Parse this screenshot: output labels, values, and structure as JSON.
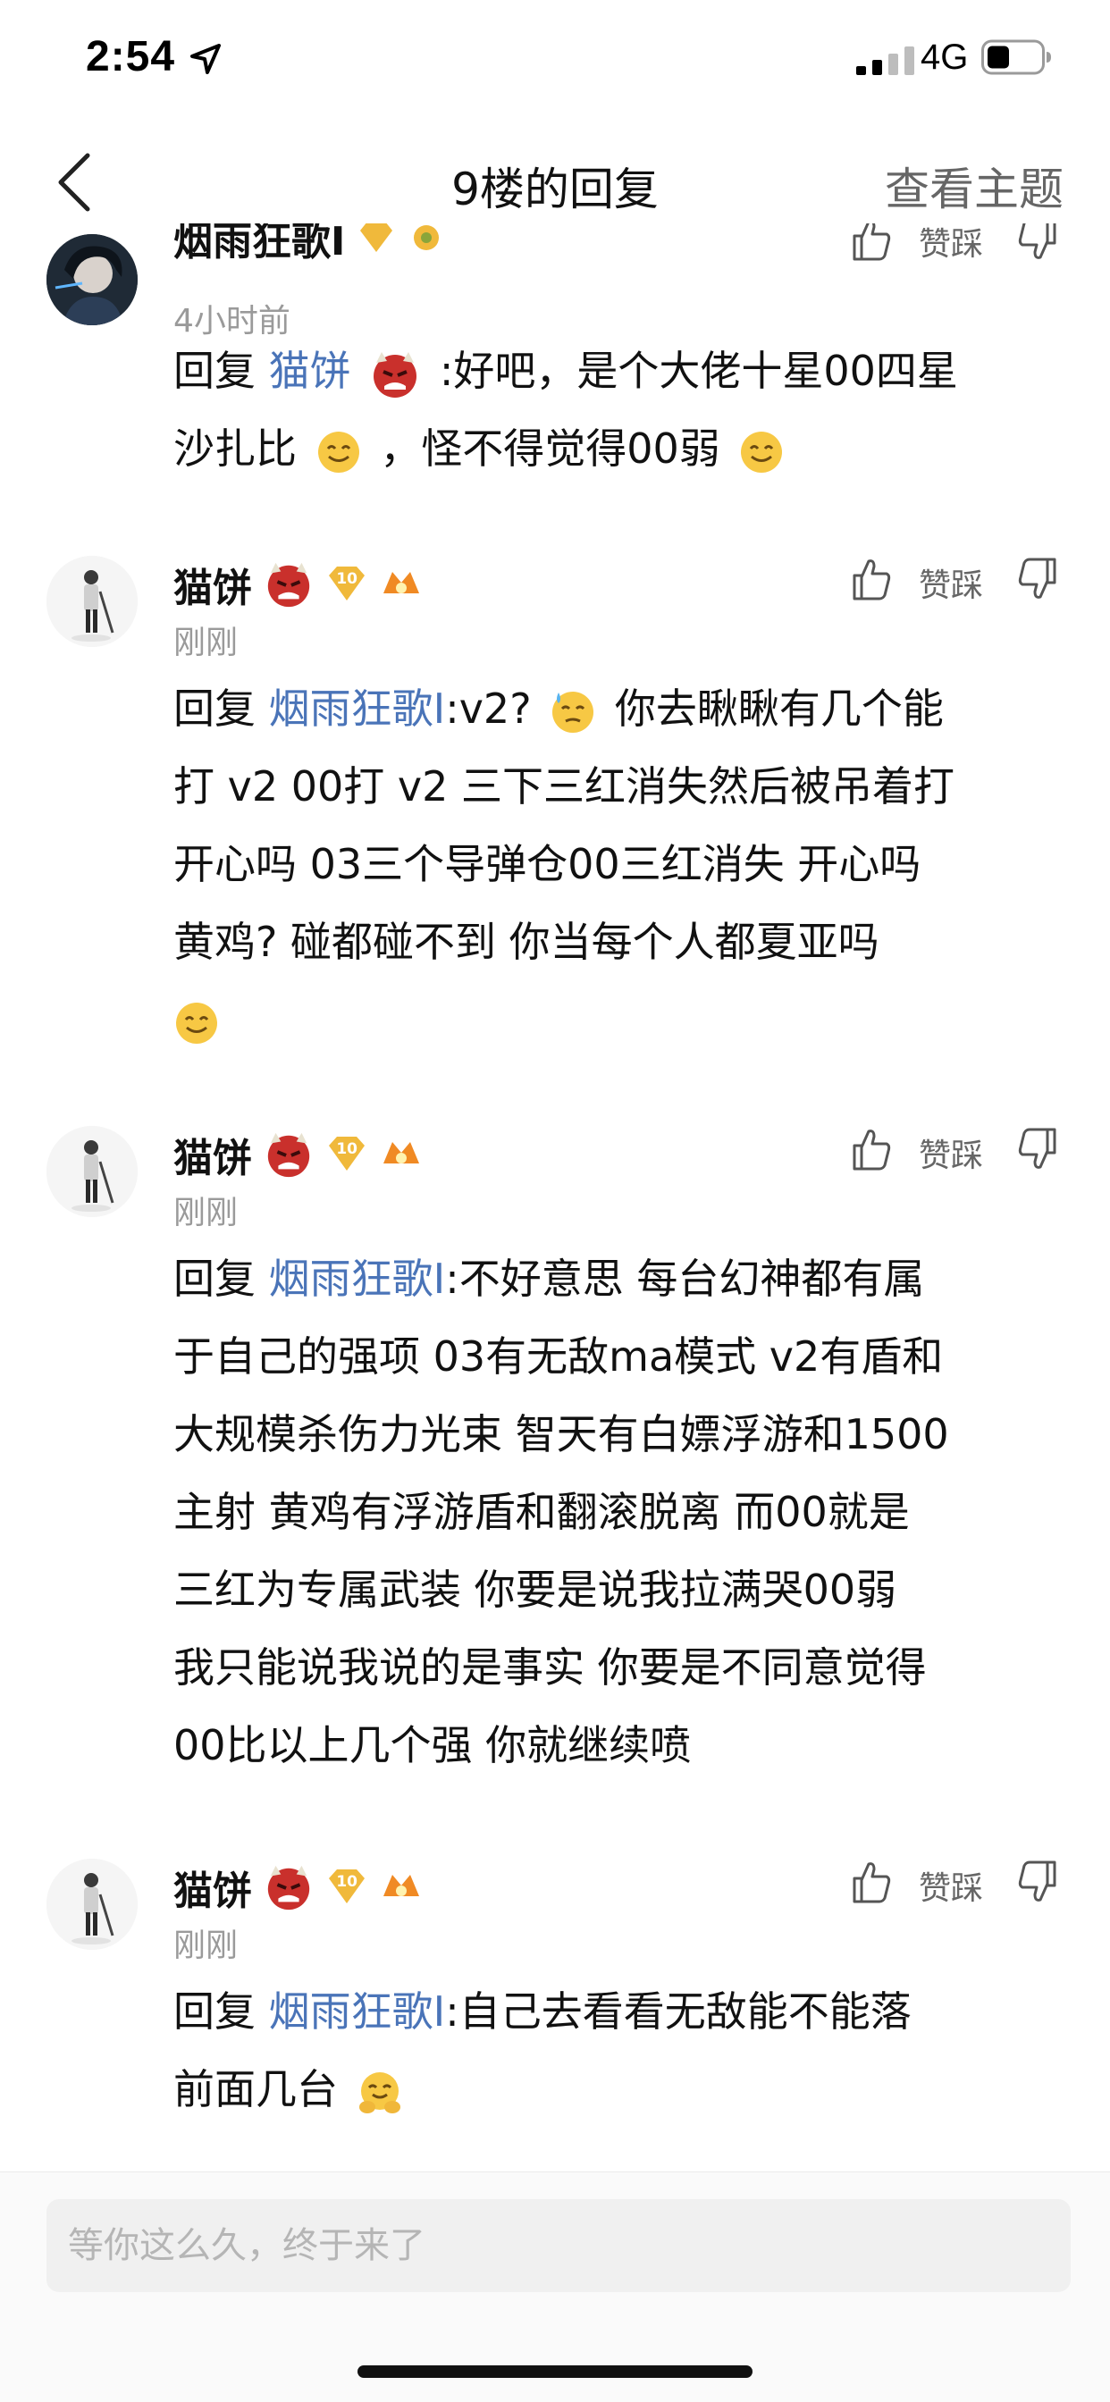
{
  "status_bar": {
    "time": "2:54",
    "network": "4G",
    "icons": [
      "location-arrow-icon",
      "signal-icon",
      "battery-icon"
    ]
  },
  "nav": {
    "title": "9楼的回复",
    "action": "查看主题",
    "back_icon": "chevron-left-icon"
  },
  "vote_label": "赞踩",
  "colors": {
    "reply_link": "#4a74b8",
    "badge_gold": "#f0b93b",
    "badge_orange": "#f08a24",
    "time_gray": "#9a9a9a"
  },
  "comments": [
    {
      "user": "烟雨狂歌I",
      "time": "4小时前",
      "reply_prefix": "回复",
      "reply_to": "猫饼",
      "text_lines": [
        ":好吧，是个大佬十星00四星",
        "沙扎比",
        "，怪不得觉得00弱"
      ]
    },
    {
      "user": "猫饼",
      "time": "刚刚",
      "level": "10",
      "reply_prefix": "回复",
      "reply_to": "烟雨狂歌I",
      "text_lines": [
        ":v2?",
        "你去瞅瞅有几个能",
        "打 v2 00打 v2 三下三红消失然后被吊着打",
        "开心吗 03三个导弹仓00三红消失 开心吗",
        "黄鸡?  碰都碰不到 你当每个人都夏亚吗"
      ]
    },
    {
      "user": "猫饼",
      "time": "刚刚",
      "level": "10",
      "reply_prefix": "回复",
      "reply_to": "烟雨狂歌I",
      "text_lines": [
        ":不好意思 每台幻神都有属",
        "于自己的强项 03有无敌ma模式 v2有盾和",
        "大规模杀伤力光束 智天有白嫖浮游和1500",
        "主射 黄鸡有浮游盾和翻滚脱离 而00就是",
        "三红为专属武装 你要是说我拉满哭00弱",
        "我只能说我说的是事实 你要是不同意觉得",
        "00比以上几个强 你就继续喷"
      ]
    },
    {
      "user": "猫饼",
      "time": "刚刚",
      "level": "10",
      "reply_prefix": "回复",
      "reply_to": "烟雨狂歌I",
      "text_lines": [
        ":自己去看看无敌能不能落",
        "前面几台"
      ]
    }
  ],
  "composer": {
    "placeholder": "等你这么久，终于来了"
  }
}
